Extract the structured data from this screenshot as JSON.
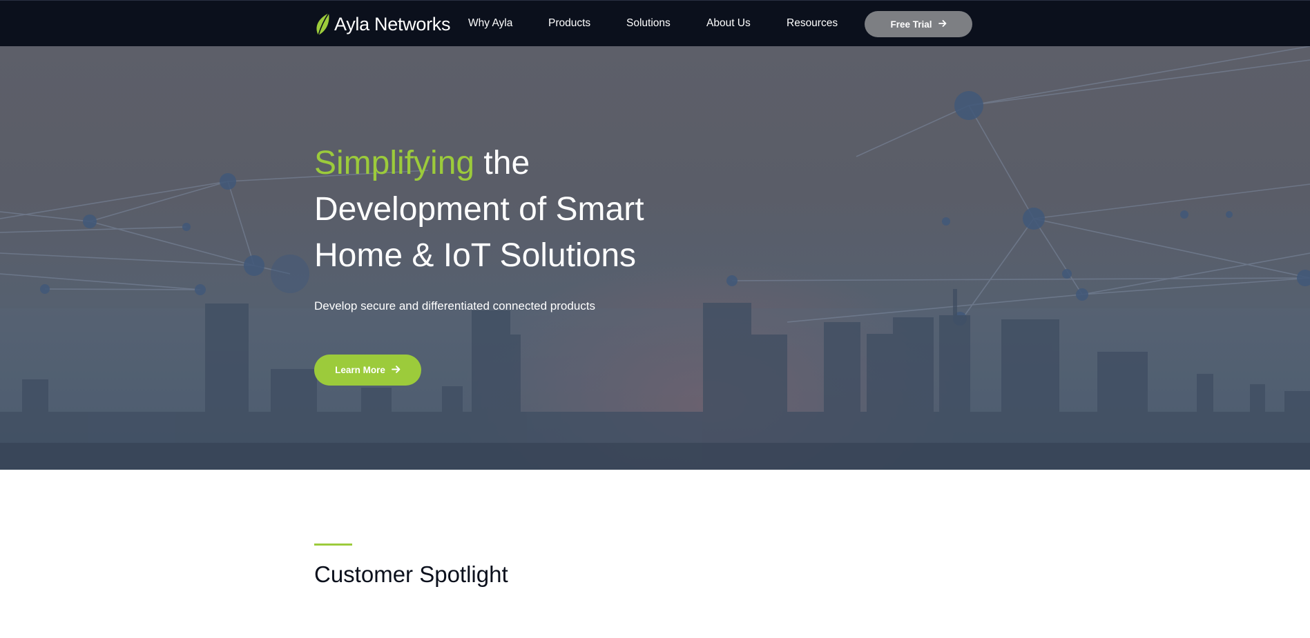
{
  "brand": {
    "name": "Ayla Networks",
    "logo_icon": "leaf-icon",
    "accent_color": "#9ccb3b",
    "nav_background": "#0b101c"
  },
  "nav": {
    "items": [
      {
        "label": "Why Ayla"
      },
      {
        "label": "Products"
      },
      {
        "label": "Solutions"
      },
      {
        "label": "About Us"
      },
      {
        "label": "Resources"
      }
    ],
    "cta": {
      "label": "Free Trial",
      "icon": "arrow-right-icon",
      "color": "#7d7f83"
    }
  },
  "hero": {
    "title_accent": "Simplifying",
    "title_rest": "the Development of Smart Home & IoT Solutions",
    "subtitle": "Develop secure and differentiated connected products",
    "cta": {
      "label": "Learn More",
      "icon": "arrow-right-icon"
    },
    "background_image": "city-skyline-network-image"
  },
  "spotlight": {
    "title": "Customer Spotlight"
  }
}
